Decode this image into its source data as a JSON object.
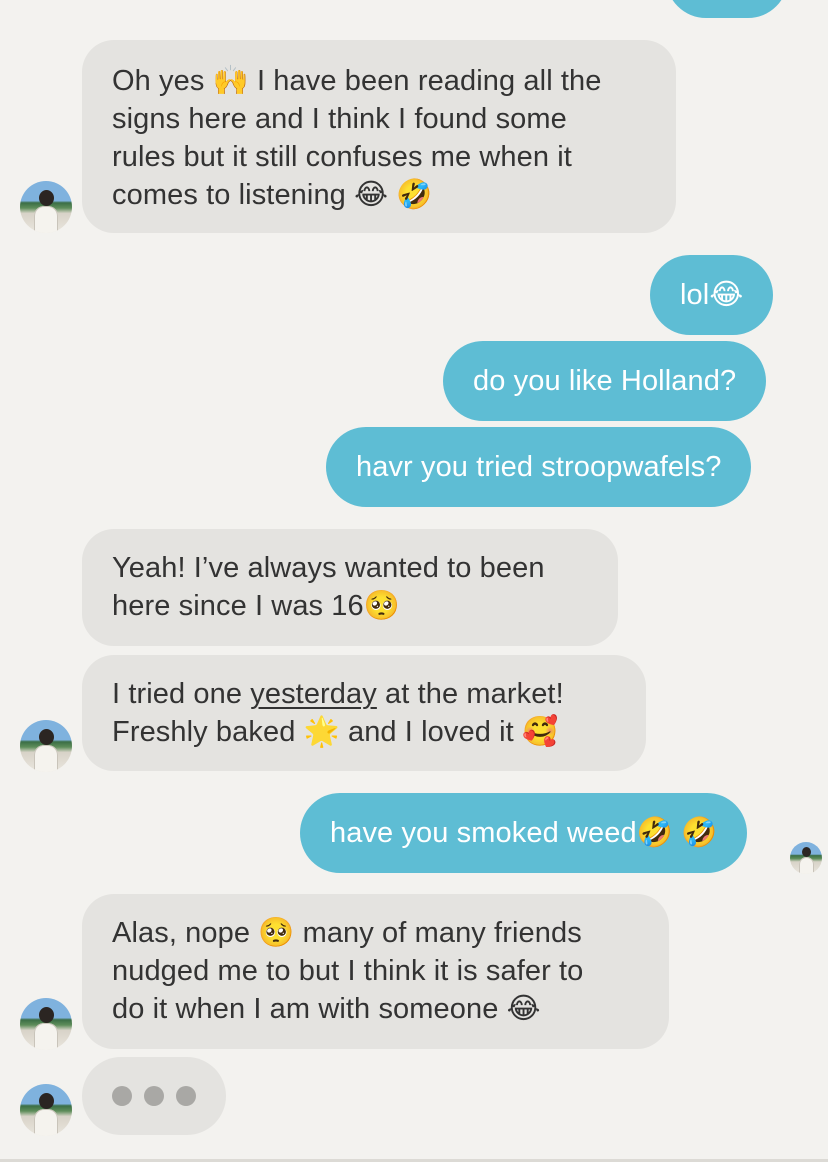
{
  "messages": [
    {
      "dir": "out",
      "lines": []
    },
    {
      "dir": "in",
      "lines": [
        "Oh yes 🙌 I have been reading all the",
        "signs here and I think I found some",
        "rules but it still confuses me when it",
        "comes to listening 😂 🤣"
      ]
    },
    {
      "dir": "out",
      "text": "lol😂"
    },
    {
      "dir": "out",
      "text": "do you like Holland?"
    },
    {
      "dir": "out",
      "text": "havr you tried stroopwafels?"
    },
    {
      "dir": "in",
      "lines": [
        "Yeah! I’ve always wanted to been",
        "here since I was 16🥺"
      ]
    },
    {
      "dir": "in",
      "lines": [
        {
          "before": "I tried one ",
          "underlined": "yesterday",
          "after": " at the market!"
        },
        "Freshly baked 🌟 and I loved it 🥰"
      ]
    },
    {
      "dir": "out",
      "text": "have you smoked weed🤣 🤣"
    },
    {
      "dir": "in",
      "lines": [
        "Alas, nope 🥺 many of many friends",
        "nudged me to but I think it is safer to",
        "do it when I am with someone 😂"
      ]
    }
  ],
  "typing_indicator": {
    "dots": 3
  },
  "avatar": {
    "icon": "contact-avatar-photo"
  },
  "colors": {
    "background": "#f3f2ef",
    "incoming_bubble": "#e4e3e0",
    "outgoing_bubble": "#5ebdd4",
    "incoming_text": "#333333",
    "outgoing_text": "#ffffff"
  }
}
